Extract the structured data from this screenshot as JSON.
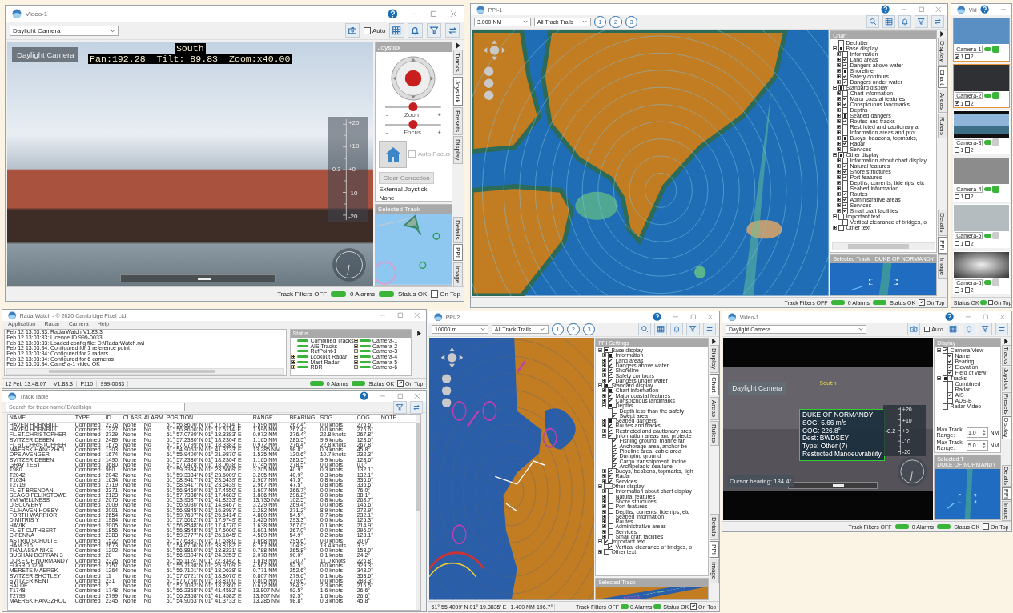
{
  "windows": [
    {
      "kind": "video",
      "title": "Video-1",
      "camera": "Daylight Camera",
      "auto": {
        "label": "Auto",
        "checked": false
      },
      "video": {
        "kind": "harbour",
        "label": "Daylight Camera",
        "heading": "South",
        "osd": "Pan:192.28  Tilt: 89.83  Zoom:x40.00",
        "elevation": "-0.3",
        "scale": [
          "+20",
          "+10",
          "+0",
          "-10",
          "-20"
        ]
      },
      "panel": {
        "kind": "joystick",
        "title": "Joystick",
        "sliders": [
          {
            "label": "Zoom",
            "minus": "-",
            "plus": "+",
            "level": 0.5
          },
          {
            "label": "Focus",
            "minus": "-",
            "plus": "+",
            "level": 0.5
          }
        ],
        "auto_focus": {
          "label": "Auto Focus",
          "checked": false,
          "disabled": true
        },
        "clear_button": {
          "label": "Clear Correction",
          "disabled": true
        },
        "external_label": "External Joystick:",
        "external_value": "None"
      },
      "selected_track": {
        "title": "Selected Track"
      },
      "tabs": [
        {
          "label": "Tracks",
          "selected": false
        },
        {
          "label": "Joystick",
          "selected": true
        },
        {
          "label": "Presets",
          "selected": false
        },
        {
          "label": "Display",
          "selected": false
        }
      ],
      "lower_tabs": [
        {
          "label": "Details",
          "selected": false
        },
        {
          "label": "PPI",
          "selected": true
        },
        {
          "label": "Image",
          "selected": false
        }
      ],
      "status": {
        "filters": "Track Filters OFF",
        "alarms": "0 Alarms",
        "status": "Status OK",
        "on_top": {
          "label": "On Top",
          "checked": false
        }
      }
    },
    {
      "kind": "ppi",
      "title": "PPI-1",
      "range": "3.000 NM",
      "trails": "All Track Trails",
      "trail_buttons": [
        "1",
        "2",
        "3"
      ],
      "settings": {
        "title": "Chart",
        "tree": [
          {
            "label": "Declutter",
            "checked": false
          },
          {
            "label": "Base display",
            "partial": true,
            "expanded": true,
            "children": [
              {
                "label": "Information",
                "checked": false,
                "expanded": false
              },
              {
                "label": "Land areas",
                "checked": true,
                "expanded": false
              },
              {
                "label": "Dangers above water",
                "checked": true,
                "expanded": false
              },
              {
                "label": "Shoreline",
                "partial": true,
                "expanded": false
              },
              {
                "label": "Safety contours",
                "checked": true,
                "expanded": false
              },
              {
                "label": "Dangers under water",
                "checked": true,
                "expanded": false
              }
            ]
          },
          {
            "label": "Standard display",
            "partial": true,
            "expanded": true,
            "children": [
              {
                "label": "Chart information",
                "checked": false,
                "expanded": false
              },
              {
                "label": "Major coastal features",
                "checked": true,
                "expanded": false
              },
              {
                "label": "Conspicuous landmarks",
                "checked": true,
                "expanded": false
              },
              {
                "label": "Depths",
                "checked": false,
                "expanded": false
              },
              {
                "label": "Seabed dangers",
                "partial": true,
                "expanded": false
              },
              {
                "label": "Routes and tracks",
                "checked": true,
                "expanded": false
              },
              {
                "label": "Restricted and cautionary a",
                "checked": false,
                "expanded": false
              },
              {
                "label": "Information areas and prot",
                "checked": false,
                "expanded": false
              },
              {
                "label": "Buoys, beacons, topmarks,",
                "partial": true,
                "expanded": false
              },
              {
                "label": "Radar",
                "checked": true,
                "expanded": false
              },
              {
                "label": "Services",
                "checked": false,
                "expanded": false
              }
            ]
          },
          {
            "label": "Other display",
            "partial": true,
            "expanded": true,
            "children": [
              {
                "label": "Information about chart display",
                "checked": false,
                "expanded": false
              },
              {
                "label": "Natural features",
                "checked": true,
                "expanded": false
              },
              {
                "label": "Shore structures",
                "checked": true,
                "expanded": false
              },
              {
                "label": "Port features",
                "checked": true,
                "expanded": false
              },
              {
                "label": "Depths, currents, tide rips, etc",
                "checked": false,
                "expanded": false
              },
              {
                "label": "Seabed information",
                "checked": false,
                "expanded": false
              },
              {
                "label": "Routes",
                "checked": true,
                "expanded": false
              },
              {
                "label": "Administrative areas",
                "checked": true,
                "expanded": false
              },
              {
                "label": "Services",
                "checked": true,
                "expanded": false
              },
              {
                "label": "Small craft facilities",
                "checked": true,
                "expanded": false
              }
            ]
          },
          {
            "label": "Important text",
            "checked": false,
            "expanded": true,
            "children": [
              {
                "label": "Vertical clearance of bridges, o",
                "checked": false
              }
            ]
          },
          {
            "label": "Other text",
            "checked": false,
            "expanded": false
          }
        ]
      },
      "selected_track": {
        "title": "Selected Track",
        "name": "DUKE OF NORMANDY"
      },
      "tabs": [
        {
          "label": "Display",
          "selected": false
        },
        {
          "label": "Chart",
          "selected": true
        },
        {
          "label": "Areas",
          "selected": false
        },
        {
          "label": "Rulers",
          "selected": false
        }
      ],
      "lower_tabs": [
        {
          "label": "Details",
          "selected": false
        },
        {
          "label": "PPI",
          "selected": true
        },
        {
          "label": "Image",
          "selected": false
        }
      ],
      "status": {
        "filters": "Track Filters OFF",
        "alarms": "0 Alarms",
        "status": "Status OK",
        "on_top": {
          "label": "On Top",
          "checked": true
        }
      }
    },
    {
      "kind": "camera_strip",
      "title": "Vid",
      "cameras": [
        {
          "name": "Camera-1",
          "selected": true,
          "recording": true,
          "monitors": [
            {
              "label": "1",
              "checked": true
            },
            {
              "label": "2",
              "checked": false
            }
          ]
        },
        {
          "name": "Camera-2",
          "selected": true,
          "recording": true,
          "monitors": [
            {
              "label": "1",
              "checked": true
            },
            {
              "label": "2",
              "checked": false
            }
          ]
        },
        {
          "name": "Camera-3",
          "selected": false,
          "recording": false,
          "monitors": [
            {
              "label": "1",
              "checked": false
            },
            {
              "label": "2",
              "checked": false
            }
          ]
        },
        {
          "name": "Camera-4",
          "selected": false,
          "recording": true,
          "monitors": [
            {
              "label": "1",
              "checked": false
            },
            {
              "label": "2",
              "checked": false
            }
          ]
        },
        {
          "name": "Camera-5",
          "selected": false,
          "recording": false,
          "monitors": [
            {
              "label": "1",
              "checked": false
            },
            {
              "label": "2",
              "checked": false
            }
          ]
        },
        {
          "name": "Camera-6",
          "selected": false,
          "recording": false,
          "monitors": [
            {
              "label": "1",
              "checked": false
            },
            {
              "label": "2",
              "checked": false
            }
          ]
        }
      ],
      "status": {
        "status": "Status OK",
        "on_top": {
          "label": "On Top",
          "checked": false
        }
      }
    },
    {
      "kind": "radarwatch",
      "title": "RadarWatch - © 2020 Cambridge Pixel Ltd.",
      "menu": [
        "Application",
        "Radar",
        "Camera",
        "Help"
      ],
      "log": [
        "Feb 12 13:03:33: RadarWatch V1.83.3",
        "Feb 12 13:03:33: Licence ID 999-0033",
        "Feb 12 13:03:33: Loaded config file: D:\\RadarWatch.rwi",
        "Feb 12 13:03:34: Configured for 1 reference point",
        "Feb 12 13:03:34: Configured for 2 radars",
        "Feb 12 13:03:34: Configured for 6 cameras",
        "Feb 12 13:03:34: Camera-1 video OK"
      ],
      "status_panel": {
        "title": "Status",
        "items": [
          {
            "label": "Combined Tracks"
          },
          {
            "label": "AIS Tracks"
          },
          {
            "label": "RefPoint-1"
          },
          {
            "label": "Lookout Radar",
            "expanded": false
          },
          {
            "label": "Mast Radar",
            "expanded": false
          },
          {
            "label": "RDR",
            "expanded": false
          },
          {
            "label": "Camera-1",
            "expanded": false
          },
          {
            "label": "Camera-2",
            "expanded": false
          },
          {
            "label": "Camera-3",
            "expanded": false
          },
          {
            "label": "Camera-4",
            "expanded": false
          },
          {
            "label": "Camera-5",
            "expanded": false
          },
          {
            "label": "Camera-6",
            "expanded": false
          }
        ]
      },
      "status": {
        "time": "12 Feb 13:48:07",
        "version": "V1.83.3",
        "code": "P110",
        "licence": "999-0033",
        "alarms": "0 Alarms",
        "status": "Status OK",
        "on_top": {
          "label": "On Top",
          "checked": true
        }
      }
    },
    {
      "kind": "track_table",
      "title": "Track Table",
      "search": {
        "placeholder": "Search for track name/ID/callsign"
      },
      "columns": [
        "NAME",
        "TYPE",
        "ID",
        "CLASS",
        "ALARM",
        "POSITION",
        "RANGE",
        "BEARING",
        "SOG",
        "COG",
        "NOTE"
      ],
      "rows": [
        [
          "HAVEN HORNBILL",
          "Combined",
          "2376",
          "None",
          "No",
          "51° 56.8600' N 01° 17.5114' E",
          "1.596 NM",
          "267.4°",
          "0.0 knots",
          "276.6°"
        ],
        [
          "HAVEN HORNBILL",
          "Combined",
          "1227",
          "None",
          "No",
          "51° 56.8600' N 01° 17.5114' E",
          "1.596 NM",
          "267.4°",
          "0.0 knots",
          "276.6°"
        ],
        [
          "FL.ST.CHRISTOPHER",
          "Combined",
          "2729",
          "None",
          "No",
          "51° 57.0799' N 01° 18.3383' E",
          "0.972 NM",
          "276.4°",
          "22.8 knots",
          "267.8°"
        ],
        [
          "SVITZER DEBEN",
          "Combined",
          "2489",
          "None",
          "No",
          "51° 57.2380' N 01° 18.2304' E",
          "1.165 NM",
          "285.5°",
          "9.9 knots",
          "128.6°"
        ],
        [
          "FL.ST.CHRISTOPHER",
          "Combined",
          "1675",
          "None",
          "No",
          "51° 57.0799' N 01° 18.3383' E",
          "0.972 NM",
          "276.4°",
          "22.8 knots",
          "267.8°"
        ],
        [
          "MAERSK HANGZHOU",
          "Combined",
          "1303",
          "None",
          "No",
          "51° 54.9053' N 01° 41.3733' E",
          "13.285 NM",
          "98.8°",
          "0.3 knots",
          "45.8°"
        ],
        [
          "OPS AVENGER",
          "Combined",
          "1674",
          "None",
          "No",
          "51° 55.9400' N 01° 21.9870' E",
          "1.535 NM",
          "130.6°",
          "10.7 knots",
          "232.3°"
        ],
        [
          "SVITZER DEBEN",
          "Combined",
          "1490",
          "None",
          "No",
          "51° 57.2380' N 01° 18.2304' E",
          "1.165 NM",
          "285.5°",
          "9.9 knots",
          "128.6°"
        ],
        [
          "GRAY TEST",
          "Combined",
          "3680",
          "None",
          "No",
          "51° 57.0478' N 01° 18.0638' E",
          "0.745 NM",
          "278.5°",
          "0.0 knots",
          "0.0°"
        ],
        [
          "T980",
          "Combined",
          "980",
          "None",
          "No",
          "51° 59.3384' N 01° 23.5009' E",
          "3.205 NM",
          "40.9°",
          "0.3 knots",
          "132.1°"
        ],
        [
          "T2042",
          "Combined",
          "2042",
          "None",
          "No",
          "51° 59.3384' N 01° 23.5009' E",
          "3.205 NM",
          "40.9°",
          "0.3 knots",
          "132.1°"
        ],
        [
          "T1634",
          "Combined",
          "1634",
          "None",
          "No",
          "51° 58.9417' N 01° 23.6439' E",
          "2.967 NM",
          "47.5°",
          "0.8 knots",
          "336.6°"
        ],
        [
          "T2719",
          "Combined",
          "2719",
          "None",
          "No",
          "51° 58.9417' N 01° 23.6439' E",
          "2.967 NM",
          "47.5°",
          "0.8 knots",
          "336.6°"
        ],
        [
          "FL ST BRENDAN",
          "Combined",
          "2371",
          "None",
          "No",
          "51° 56.8469' N 01° 17.4550' E",
          "1.607 NM",
          "266.7°",
          "0.0 knots",
          "76.0°"
        ],
        [
          "SEAGO FELIXSTOWE",
          "Combined",
          "2123",
          "None",
          "No",
          "51° 57.7338' N 01° 17.4683' E",
          "1.806 NM",
          "296.2°",
          "0.0 knots",
          "38.1°"
        ],
        [
          "YM WELLNESS",
          "Combined",
          "2075",
          "None",
          "No",
          "51° 53.9587' N 01° 41.8233' E",
          "13.735 NM",
          "102.5°",
          "0.8 knots",
          "268.7°"
        ],
        [
          "DISCOVERY",
          "Combined",
          "2009",
          "None",
          "No",
          "51° 56.9030' N 01° 14.8467' E",
          "3.229 NM",
          "269.4°",
          "0.0 knots",
          "145.6°"
        ],
        [
          "F.L.HAVEN HOBBY",
          "Combined",
          "2001",
          "None",
          "No",
          "51° 56.9845' N 01° 16.3987' E",
          "2.282 NM",
          "271.2°",
          "8.9 knots",
          "272.9°"
        ],
        [
          "FORTH WARRIOR",
          "Combined",
          "2654",
          "None",
          "No",
          "51° 59.7697' N 01° 26.5414' E",
          "4.880 NM",
          "54.5°",
          "0.7 knots",
          "232.1°"
        ],
        [
          "DIMITRIS Y",
          "Combined",
          "1984",
          "None",
          "No",
          "51° 57.5012' N 01° 17.9749' E",
          "1.425 NM",
          "293.3°",
          "0.0 knots",
          "125.3°"
        ],
        [
          "HAVIK",
          "Combined",
          "2005",
          "None",
          "No",
          "51° 56.8548' N 01° 17.4770' E",
          "1.638 NM",
          "267.0°",
          "0.1 knots",
          "214.9°"
        ],
        [
          "FL ST CUTHBERT",
          "Combined",
          "1856",
          "None",
          "No",
          "51° 56.8548' N 01° 17.5000' E",
          "1.601 NM",
          "267.0°",
          "0.0 knots",
          "296.0°"
        ],
        [
          "C-FENNA",
          "Combined",
          "2383",
          "None",
          "No",
          "51° 59.3777' N 01° 26.1845' E",
          "4.589 NM",
          "54.9°",
          "0.2 knots",
          "128.1°"
        ],
        [
          "ASTRID SCHULTE",
          "Combined",
          "1522",
          "None",
          "No",
          "51° 57.6381' N 01° 17.6380' E",
          "1.668 NM",
          "295.6°",
          "0.0 knots",
          "20.0°"
        ],
        [
          "HAM 316",
          "Combined",
          "2673",
          "None",
          "No",
          "51° 54.6706' N 01° 33.8182' E",
          "8.787 NM",
          "104.9°",
          "13.4 knots",
          "3.3°"
        ],
        [
          "THALASSA NIKE",
          "Combined",
          "1202",
          "None",
          "No",
          "51° 56.8810' N 01° 18.8231' E",
          "0.788 NM",
          "265.8°",
          "0.0 knots",
          "158.0°"
        ],
        [
          "BUSHAN DOPRAN 3",
          "Combined",
          "20",
          "None",
          "No",
          "51° 56.9304' N 01° 24.0253' E",
          "2.078 NM",
          "90.0°",
          "0.1 knots",
          "24.2°"
        ],
        [
          "DUKE OF NORMANDY",
          "Combined",
          "2326",
          "None",
          "No",
          "51° 56.1124' N 01° 22.3342' E",
          "1.619 NM",
          "120.7°",
          "11.0 knots",
          "226.8°"
        ],
        [
          "FUGRO 1200",
          "Combined",
          "2757",
          "None",
          "No",
          "51° 55.7198' N 01° 25.9709' E",
          "4.567 NM",
          "52.5°",
          "0.0 knots",
          "329.3°"
        ],
        [
          "MERETE MAERSK",
          "Combined",
          "1264",
          "None",
          "No",
          "51° 56.7101' N 01° 18.0638' E",
          "0.771 NM",
          "252.6°",
          "0.0 knots",
          "348.0°"
        ],
        [
          "SVITZER SHOTLEY",
          "Combined",
          "11",
          "None",
          "No",
          "51° 57.6721' N 01° 18.8070' E",
          "0.807 NM",
          "279.6°",
          "0.1 knots",
          "358.6°"
        ],
        [
          "SVITZER KENT",
          "Combined",
          "231",
          "None",
          "No",
          "51° 57.0760' N 01° 18.8100' E",
          "0.805 NM",
          "279.6°",
          "0.0 knots",
          "288.3°"
        ],
        [
          "SALDE",
          "Combined",
          "2",
          "None",
          "No",
          "51° 57.1032' N 01° 18.7360' E",
          "0.672 NM",
          "284.3°",
          "2.3 knots",
          "216.5°"
        ],
        [
          "T1748",
          "Combined",
          "1748",
          "None",
          "No",
          "51° 56.2358' N 01° 41.4582' E",
          "13.807 NM",
          "92.5°",
          "1.6 knots",
          "26.6°"
        ],
        [
          "T2799",
          "Combined",
          "2799",
          "None",
          "No",
          "51° 56.2358' N 01° 41.4582' E",
          "13.807 NM",
          "92.5°",
          "1.6 knots",
          "26.6°"
        ],
        [
          "MAERSK HANGZHOU",
          "Combined",
          "2345",
          "None",
          "No",
          "51° 54.9053' N 01° 41.3733' E",
          "13.285 NM",
          "98.8°",
          "0.3 knots",
          "45.8°"
        ]
      ]
    },
    {
      "kind": "ppi",
      "title": "PPI-2",
      "range": "10000 m",
      "trails": "All Track Trails",
      "trail_buttons": [
        "1",
        "2",
        "3"
      ],
      "settings": {
        "title": "PPI Settings",
        "tree": [
          {
            "label": "Base display",
            "partial": true,
            "expanded": true,
            "children": [
              {
                "label": "Information",
                "partial": true,
                "expanded": false
              },
              {
                "label": "Land areas",
                "checked": true,
                "expanded": false
              },
              {
                "label": "Dangers above water",
                "checked": true,
                "expanded": false
              },
              {
                "label": "Shoreline",
                "checked": true,
                "expanded": false
              },
              {
                "label": "Safety contours",
                "checked": true,
                "expanded": false
              },
              {
                "label": "Dangers under water",
                "checked": true,
                "expanded": false
              }
            ]
          },
          {
            "label": "Standard display",
            "partial": true,
            "expanded": true,
            "children": [
              {
                "label": "Chart information",
                "partial": true,
                "expanded": false
              },
              {
                "label": "Major coastal features",
                "checked": true,
                "expanded": false
              },
              {
                "label": "Conspicuous landmarks",
                "checked": true,
                "expanded": false
              },
              {
                "label": "Depths",
                "partial": true,
                "expanded": true,
                "children": [
                  {
                    "label": "Depth less than the safety",
                    "checked": false
                  },
                  {
                    "label": "Swept area",
                    "checked": true
                  }
                ]
              },
              {
                "label": "Seabed dangers",
                "partial": true,
                "expanded": false
              },
              {
                "label": "Routes and tracks",
                "checked": true,
                "expanded": false
              },
              {
                "label": "Restricted and cautionary area",
                "checked": true,
                "expanded": false
              },
              {
                "label": "Information areas and protecte",
                "checked": true,
                "expanded": true,
                "children": [
                  {
                    "label": "Fishing ground, marine far",
                    "checked": true
                  },
                  {
                    "label": "Anchorage area, anchor be",
                    "checked": true
                  },
                  {
                    "label": "Pipeline area, cable area",
                    "checked": true
                  },
                  {
                    "label": "Dumping ground",
                    "checked": true
                  },
                  {
                    "label": "Cargo transhipment, incine",
                    "checked": true
                  },
                  {
                    "label": "Archipelagic sea lane",
                    "checked": true
                  }
                ]
              },
              {
                "label": "Buoys, beacons, topmarks, ligh",
                "checked": true,
                "expanded": false
              },
              {
                "label": "Radar",
                "checked": true,
                "expanded": false
              },
              {
                "label": "Services",
                "checked": true,
                "expanded": false
              }
            ]
          },
          {
            "label": "Other display",
            "checked": false,
            "expanded": true,
            "children": [
              {
                "label": "Information about chart display",
                "checked": false,
                "expanded": false
              },
              {
                "label": "Natural features",
                "checked": false,
                "expanded": false
              },
              {
                "label": "Shore structures",
                "checked": false,
                "expanded": false
              },
              {
                "label": "Port features",
                "checked": false,
                "expanded": false
              },
              {
                "label": "Depths, currents, tide rips, etc",
                "checked": false,
                "expanded": false
              },
              {
                "label": "Seabed information",
                "checked": false,
                "expanded": false
              },
              {
                "label": "Routes",
                "checked": false,
                "expanded": false
              },
              {
                "label": "Administrative areas",
                "checked": false,
                "expanded": false
              },
              {
                "label": "Services",
                "checked": false,
                "expanded": false
              },
              {
                "label": "Small craft facilities",
                "checked": false,
                "expanded": false
              }
            ]
          },
          {
            "label": "Important text",
            "checked": true,
            "expanded": true,
            "children": [
              {
                "label": "Vertical clearance of bridges, o",
                "checked": true
              }
            ]
          },
          {
            "label": "Other text",
            "checked": false,
            "expanded": false
          }
        ]
      },
      "selected_track": {
        "title": "Selected Track"
      },
      "tabs": [
        {
          "label": "Display",
          "selected": false
        },
        {
          "label": "Chart",
          "selected": true
        },
        {
          "label": "Areas",
          "selected": false
        },
        {
          "label": "Rulers",
          "selected": false
        }
      ],
      "lower_tabs": [
        {
          "label": "Details",
          "selected": false
        },
        {
          "label": "PPI",
          "selected": true
        },
        {
          "label": "Image",
          "selected": false
        }
      ],
      "status": {
        "position": "51° 55.4099' N 01° 19.3835' E",
        "range_bearing": "1.400 NM 196.7°",
        "filters": "Track Filters OFF",
        "alarms": "0 Alarms",
        "status": "Status OK",
        "on_top": {
          "label": "On Top",
          "checked": true
        }
      }
    },
    {
      "kind": "video",
      "title": "Video-1",
      "camera": "Daylight Camera",
      "auto": {
        "label": "Auto",
        "checked": false
      },
      "video": {
        "kind": "sea",
        "label": "Daylight Camera",
        "heading": "South",
        "elevation": "-0.2",
        "scale": [
          "+20",
          "+10",
          "+0",
          "-10",
          "-20"
        ],
        "track_box": [
          "DUKE OF NORMANDY",
          "SOG: 5.66 m/s",
          "COG: 226.8°",
          "Dest: BWDSEY",
          "Type: Other (7)",
          "Restricted Manoeuvrability"
        ],
        "cursor": "Cursor bearing: 184.4°"
      },
      "panel": {
        "kind": "display",
        "title": "Display",
        "tree": [
          {
            "label": "Camera View",
            "checked": true,
            "expanded": true,
            "children": [
              {
                "label": "Name",
                "checked": true
              },
              {
                "label": "Bearing",
                "checked": true
              },
              {
                "label": "Elevation",
                "checked": true
              },
              {
                "label": "Field of view",
                "checked": true
              }
            ]
          },
          {
            "label": "Tracks",
            "partial": true,
            "expanded": true,
            "children": [
              {
                "label": "Combined",
                "checked": false
              },
              {
                "label": "Radar",
                "checked": false
              },
              {
                "label": "AIS",
                "checked": true
              },
              {
                "label": "ADS-B",
                "checked": false
              }
            ]
          },
          {
            "label": "Radar Video",
            "checked": false
          }
        ],
        "ranges": [
          {
            "label": "Max Track Range:",
            "value": "1.0",
            "unit": "NM"
          },
          {
            "label": "Max Track Range:",
            "value": "5.0",
            "unit": "NM"
          }
        ]
      },
      "selected_track": {
        "title": "Selected T",
        "name": "DUKE OF NORMANDY"
      },
      "tabs": [
        {
          "label": "Tracks",
          "selected": false
        },
        {
          "label": "Joystick",
          "selected": false
        },
        {
          "label": "Presets",
          "selected": false
        },
        {
          "label": "Display",
          "selected": true
        }
      ],
      "lower_tabs": [
        {
          "label": "Details",
          "selected": false
        },
        {
          "label": "PPI",
          "selected": true
        },
        {
          "label": "Image",
          "selected": false
        }
      ],
      "status": {
        "filters": "Track Filters OFF",
        "alarms": "0 Alarms",
        "status": "Status OK",
        "on_top": {
          "label": "On Top",
          "checked": false
        }
      }
    }
  ]
}
